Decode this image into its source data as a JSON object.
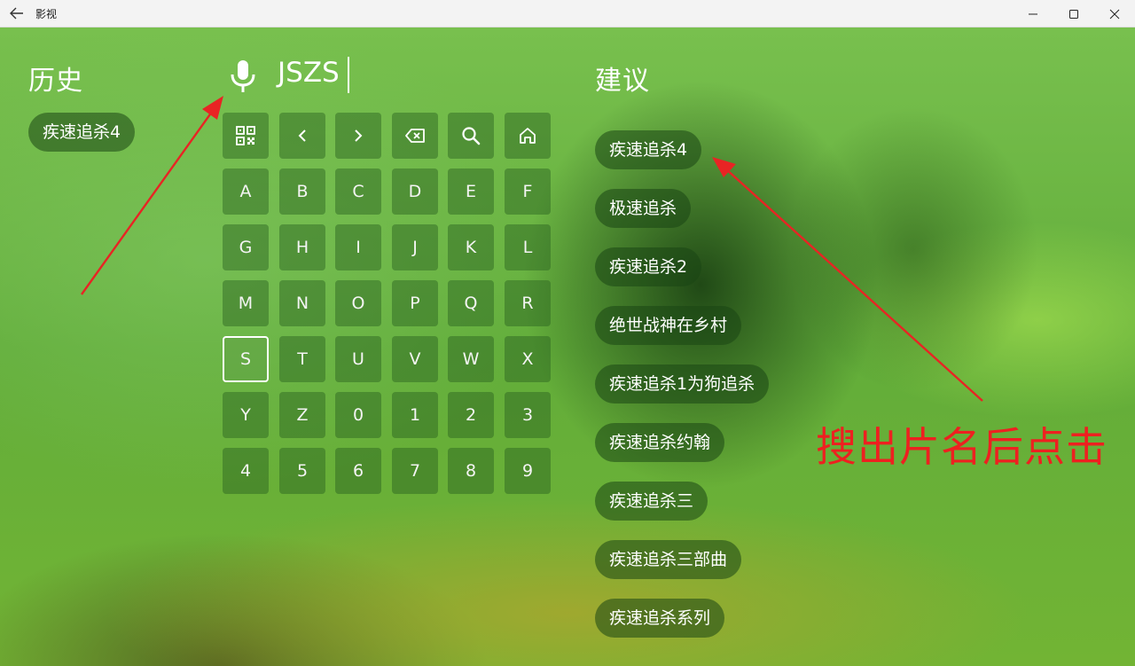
{
  "window": {
    "title": "影视",
    "back_icon": "arrow-left-icon",
    "minimize_icon": "minimize-icon",
    "maximize_icon": "maximize-icon",
    "close_icon": "close-icon"
  },
  "history": {
    "heading": "历史",
    "items": [
      "疾速追杀4"
    ]
  },
  "search": {
    "mic_icon": "microphone-icon",
    "query": "JSZS"
  },
  "keyboard": {
    "function_keys": [
      {
        "icon": "qr-code-icon"
      },
      {
        "icon": "chevron-left-icon"
      },
      {
        "icon": "chevron-right-icon"
      },
      {
        "icon": "backspace-icon"
      },
      {
        "icon": "search-icon"
      },
      {
        "icon": "home-icon"
      }
    ],
    "keys": [
      "A",
      "B",
      "C",
      "D",
      "E",
      "F",
      "G",
      "H",
      "I",
      "J",
      "K",
      "L",
      "M",
      "N",
      "O",
      "P",
      "Q",
      "R",
      "S",
      "T",
      "U",
      "V",
      "W",
      "X",
      "Y",
      "Z",
      "0",
      "1",
      "2",
      "3",
      "4",
      "5",
      "6",
      "7",
      "8",
      "9"
    ],
    "focused_key": "S"
  },
  "suggestions": {
    "heading": "建议",
    "items": [
      "疾速追杀4",
      "极速追杀",
      "疾速追杀2",
      "绝世战神在乡村",
      "疾速追杀1为狗追杀",
      "疾速追杀约翰",
      "疾速追杀三",
      "疾速追杀三部曲",
      "疾速追杀系列"
    ]
  },
  "annotation": {
    "text": "搜出片名后点击",
    "color": "#ee2020"
  }
}
